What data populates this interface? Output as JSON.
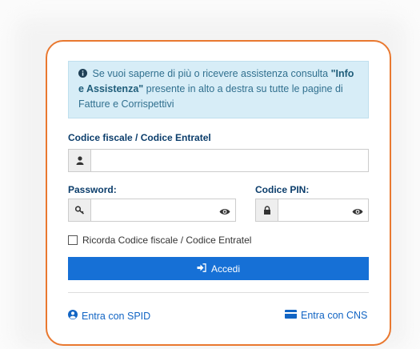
{
  "info": {
    "text_before": "Se vuoi saperne di più o ricevere assistenza consulta ",
    "highlight": "\"Info e Assistenza\"",
    "text_after": " presente in alto a destra su tutte le pagine di Fatture e Corrispettivi"
  },
  "fields": {
    "codice_fiscale_label": "Codice fiscale / Codice Entratel",
    "codice_fiscale_value": "",
    "password_label": "Password:",
    "password_value": "",
    "pin_label": "Codice PIN:",
    "pin_value": ""
  },
  "remember_label": "Ricorda Codice fiscale / Codice Entratel",
  "login_button": "Accedi",
  "spid_link": "Entra con SPID",
  "cns_link": "Entra con CNS",
  "colors": {
    "card_border": "#e9782f",
    "primary": "#1670d6",
    "label": "#0b3d6b",
    "info_bg": "#d7edf7"
  },
  "icons": [
    "info-icon",
    "user-icon",
    "key-icon",
    "eye-icon",
    "lock-icon",
    "sign-in-icon",
    "user-circle-icon",
    "id-card-icon"
  ]
}
